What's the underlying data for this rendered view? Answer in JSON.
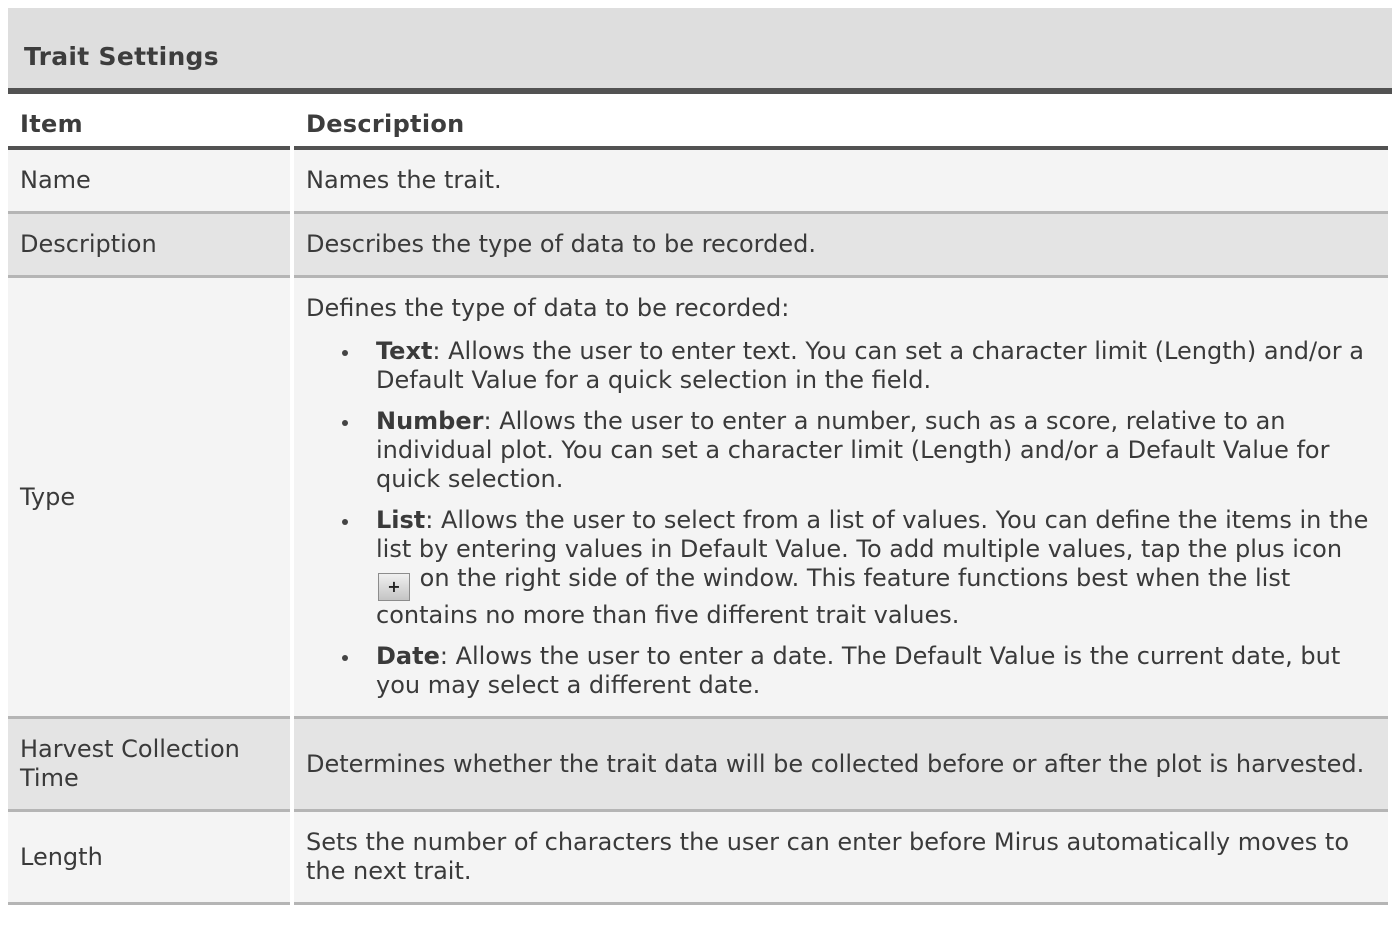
{
  "caption": "Trait Settings",
  "headers": {
    "item": "Item",
    "description": "Description"
  },
  "rows": {
    "name": {
      "item": "Name",
      "description": "Names the trait."
    },
    "description": {
      "item": "Description",
      "description": "Describes the type of data to be recorded."
    },
    "type": {
      "item": "Type",
      "intro": "Defines the type of data to be recorded:",
      "text": {
        "term": "Text",
        "body": ": Allows the user to enter text. You can set a character limit (Length) and/or a Default Value for a quick selection in the field."
      },
      "number": {
        "term": "Number",
        "body": ": Allows the user to enter a number, such as a score, relative to an individual plot. You can set a character limit (Length) and/or a Default Value for quick selection."
      },
      "list": {
        "term": "List",
        "body_before_icon": ": Allows the user to select from a list of values. You can define the items in the list by entering values in Default Value. To add multiple values, tap the plus icon",
        "icon_glyph": "+",
        "body_after_icon": "on the right side of the window. This feature functions best when the list contains no more than five different trait values."
      },
      "date": {
        "term": "Date",
        "body": ": Allows the user to enter a date. The Default Value is the current date, but you may select a different date."
      }
    },
    "harvest": {
      "item": "Harvest Collection Time",
      "description": "Determines whether the trait data will be collected before or after the plot is harvested."
    },
    "length": {
      "item": "Length",
      "description": "Sets the number of characters the user can enter before Mirus automatically moves to the next trait."
    }
  },
  "icons": {
    "plus": "plus-icon"
  }
}
